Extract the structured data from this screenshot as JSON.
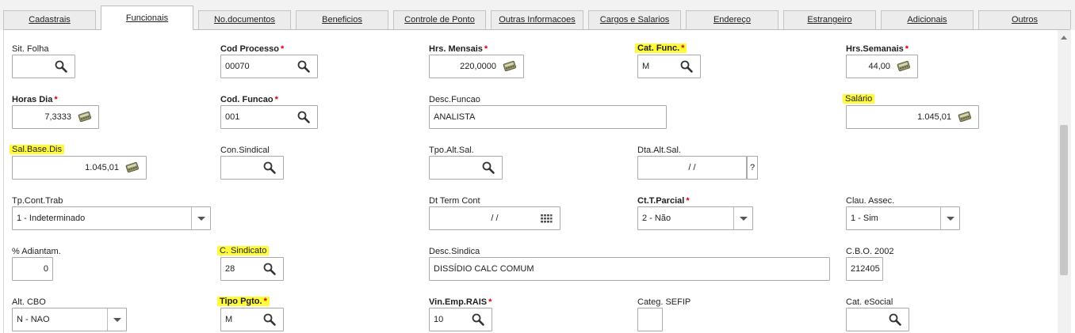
{
  "tabs": [
    {
      "id": "cadastrais",
      "label": "Cadastrais"
    },
    {
      "id": "funcionais",
      "label": "Funcionais"
    },
    {
      "id": "no-documentos",
      "label": "No.documentos"
    },
    {
      "id": "beneficios",
      "label": "Beneficios"
    },
    {
      "id": "controle-ponto",
      "label": "Controle de Ponto"
    },
    {
      "id": "outras-informacoes",
      "label": "Outras Informacoes"
    },
    {
      "id": "cargos-salarios",
      "label": "Cargos e Salarios"
    },
    {
      "id": "endereco",
      "label": "Endereço"
    },
    {
      "id": "estrangeiro",
      "label": "Estrangeiro"
    },
    {
      "id": "adicionais",
      "label": "Adicionais"
    },
    {
      "id": "outros",
      "label": "Outros"
    }
  ],
  "active_tab": "Funcionais",
  "colors": {
    "highlight": "#fffa3a",
    "required": "#d30000"
  },
  "icons": {
    "lookup": "search-icon",
    "calculator": "calculator-icon",
    "calendar": "calendar-icon",
    "dropdown": "chevron-down-icon"
  },
  "fields": {
    "sit_folha": {
      "label": "Sit. Folha",
      "value": ""
    },
    "cod_processo": {
      "label": "Cod Processo",
      "req": "*",
      "value": "00070"
    },
    "hrs_mensais": {
      "label": "Hrs. Mensais",
      "req": "*",
      "value": "220,0000"
    },
    "cat_func": {
      "label": "Cat. Func.",
      "req": "*",
      "value": "M"
    },
    "hrs_semanais": {
      "label": "Hrs.Semanais",
      "req": "*",
      "value": "44,00"
    },
    "horas_dia": {
      "label": "Horas Dia",
      "req": "*",
      "value": "7,3333"
    },
    "cod_funcao": {
      "label": "Cod. Funcao",
      "req": "*",
      "value": "001"
    },
    "desc_funcao": {
      "label": "Desc.Funcao",
      "value": "ANALISTA"
    },
    "salario": {
      "label": "Salário",
      "value": "1.045,01"
    },
    "sal_base_dis": {
      "label": "Sal.Base.Dis",
      "value": "1.045,01"
    },
    "con_sindical": {
      "label": "Con.Sindical",
      "value": ""
    },
    "tpo_alt_sal": {
      "label": "Tpo.Alt.Sal.",
      "value": ""
    },
    "dta_alt_sal": {
      "label": "Dta.Alt.Sal.",
      "value": "/  /",
      "help": "?"
    },
    "tp_cont_trab": {
      "label": "Tp.Cont.Trab",
      "value": "1 - Indeterminado"
    },
    "dt_term_cont": {
      "label": "Dt Term Cont",
      "value": "/  /"
    },
    "ct_t_parcial": {
      "label": "Ct.T.Parcial",
      "req": "*",
      "value": "2 - Não"
    },
    "clau_assec": {
      "label": "Clau. Assec.",
      "value": "1 - Sim"
    },
    "pct_adiantam": {
      "label": "% Adiantam.",
      "value": "0"
    },
    "c_sindicato": {
      "label": "C. Sindicato",
      "value": "28"
    },
    "desc_sindica": {
      "label": "Desc.Sindica",
      "value": "DISSÍDIO CALC COMUM"
    },
    "cbo_2002": {
      "label": "C.B.O. 2002",
      "value": "212405"
    },
    "alt_cbo": {
      "label": "Alt. CBO",
      "value": "N - NAO"
    },
    "tipo_pgto": {
      "label": "Tipo Pgto.",
      "req": "*",
      "value": "M"
    },
    "vin_emp_rais": {
      "label": "Vin.Emp.RAIS",
      "req": "*",
      "value": "10"
    },
    "categ_sefip": {
      "label": "Categ. SEFIP",
      "value": ""
    },
    "cat_esocial": {
      "label": "Cat. eSocial",
      "value": ""
    }
  }
}
